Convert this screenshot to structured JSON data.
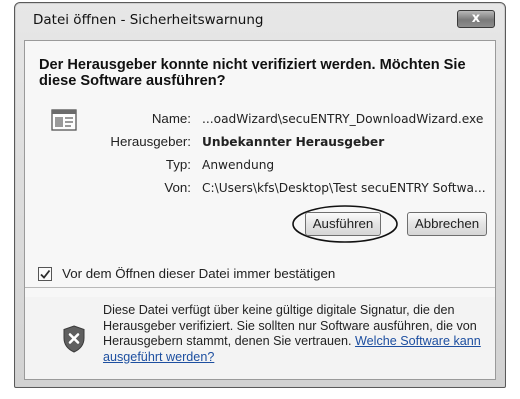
{
  "window": {
    "title": "Datei öffnen - Sicherheitswarnung",
    "close_label": "x"
  },
  "headline": "Der Herausgeber konnte nicht verifiziert werden. Möchten Sie diese Software ausführen?",
  "details": {
    "name_label": "Name:",
    "name_value": "...oadWizard\\secuENTRY_DownloadWizard.exe",
    "publisher_label": "Herausgeber:",
    "publisher_value": "Unbekannter Herausgeber",
    "type_label": "Typ:",
    "type_value": "Anwendung",
    "from_label": "Von:",
    "from_value": "C:\\Users\\kfs\\Desktop\\Test secuENTRY Softwa..."
  },
  "buttons": {
    "run_label": "Ausführen",
    "cancel_label": "Abbrechen"
  },
  "checkbox": {
    "label": "Vor dem Öffnen dieser Datei immer bestätigen",
    "checked": true
  },
  "warning": {
    "text": "Diese Datei verfügt über keine gültige digitale Signatur, die den Herausgeber verifiziert. Sie sollten nur Software ausführen, die von Herausgebern stammt, denen Sie vertrauen.",
    "link_text": "Welche Software kann ausgeführt werden?"
  },
  "icons": {
    "app": "application-icon",
    "shield": "security-shield-icon",
    "close": "close-icon",
    "check": "checkmark-icon"
  },
  "colors": {
    "link": "#1d4fa0",
    "shield": "#5f5f5f"
  }
}
